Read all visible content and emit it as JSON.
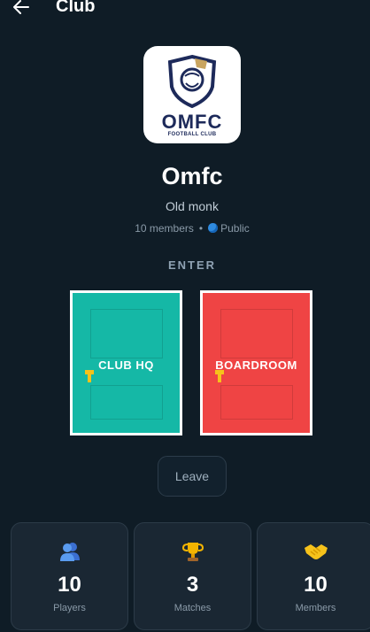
{
  "header": {
    "title": "Club",
    "back_icon": "arrow-left-icon"
  },
  "club": {
    "logo": {
      "text": "OMFC",
      "subtitle": "FOOTBALL CLUB"
    },
    "name": "Omfc",
    "description": "Old monk",
    "members_text": "10 members",
    "separator": "•",
    "visibility": "Public",
    "visibility_icon": "globe-icon"
  },
  "enter": {
    "label": "ENTER",
    "doors": [
      {
        "label": "CLUB HQ",
        "color": "#15b8a6"
      },
      {
        "label": "BOARDROOM",
        "color": "#ef4444"
      }
    ]
  },
  "actions": {
    "leave_label": "Leave"
  },
  "stats": [
    {
      "icon": "players-icon",
      "value": "10",
      "label": "Players"
    },
    {
      "icon": "trophy-icon",
      "value": "3",
      "label": "Matches"
    },
    {
      "icon": "handshake-icon",
      "value": "10",
      "label": "Members"
    }
  ],
  "colors": {
    "background": "#0f1c26",
    "card": "#1a2733",
    "accent_teal": "#15b8a6",
    "accent_red": "#ef4444"
  }
}
